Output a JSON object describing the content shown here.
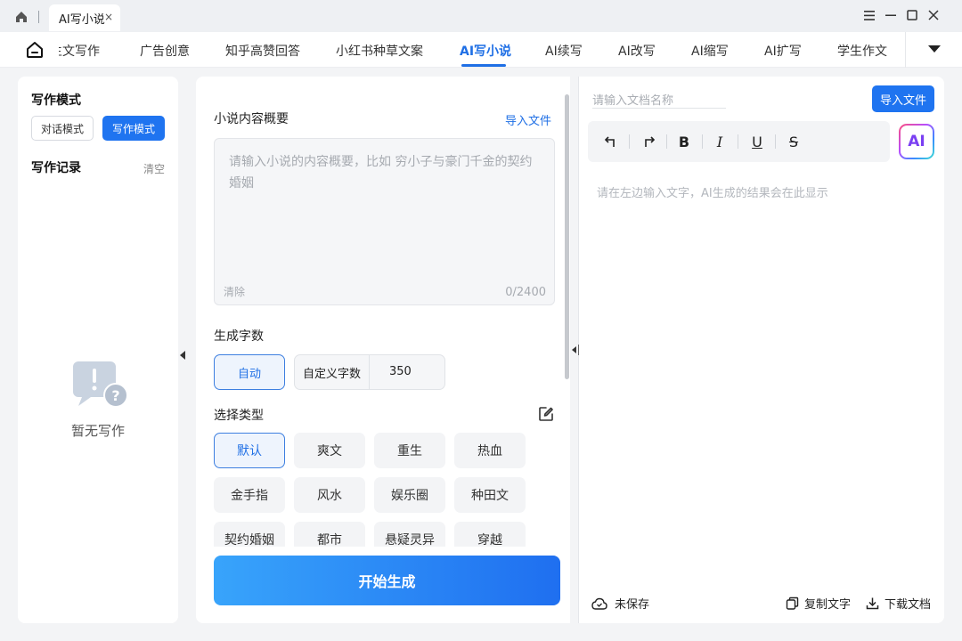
{
  "titlebar": {
    "tab_label": "AI写小说",
    "tab_close": "×"
  },
  "nav": {
    "items": [
      "主文写作",
      "广告创意",
      "知乎高赞回答",
      "小红书种草文案",
      "AI写小说",
      "AI续写",
      "AI改写",
      "AI缩写",
      "AI扩写",
      "学生作文"
    ],
    "active_index": 4
  },
  "sidebar": {
    "mode_title": "写作模式",
    "mode_options": [
      "对话模式",
      "写作模式"
    ],
    "active_mode": "写作模式",
    "record_title": "写作记录",
    "clear_label": "清空",
    "empty_text": "暂无写作"
  },
  "main": {
    "summary_label": "小说内容概要",
    "import_label": "导入文件",
    "summary_placeholder": "请输入小说的内容概要，比如 穷小子与豪门千金的契约婚姻",
    "clear_label": "清除",
    "char_count": "0/2400",
    "wordcount_label": "生成字数",
    "auto_label": "自动",
    "custom_label": "自定义字数",
    "custom_value": "350",
    "type_label": "选择类型",
    "types": [
      "默认",
      "爽文",
      "重生",
      "热血",
      "金手指",
      "风水",
      "娱乐圈",
      "种田文",
      "契约婚姻",
      "都市",
      "悬疑灵异",
      "穿越"
    ],
    "selected_type": "默认",
    "generate_label": "开始生成"
  },
  "editor": {
    "doc_name_placeholder": "请输入文档名称",
    "import_label": "导入文件",
    "ai_label": "AI",
    "output_hint": "请在左边输入文字，AI生成的结果会在此显示",
    "unsaved_label": "未保存",
    "copy_label": "复制文字",
    "download_label": "下载文档"
  },
  "colors": {
    "accent": "#1f74f0",
    "active_nav": "#1f6fe5"
  }
}
